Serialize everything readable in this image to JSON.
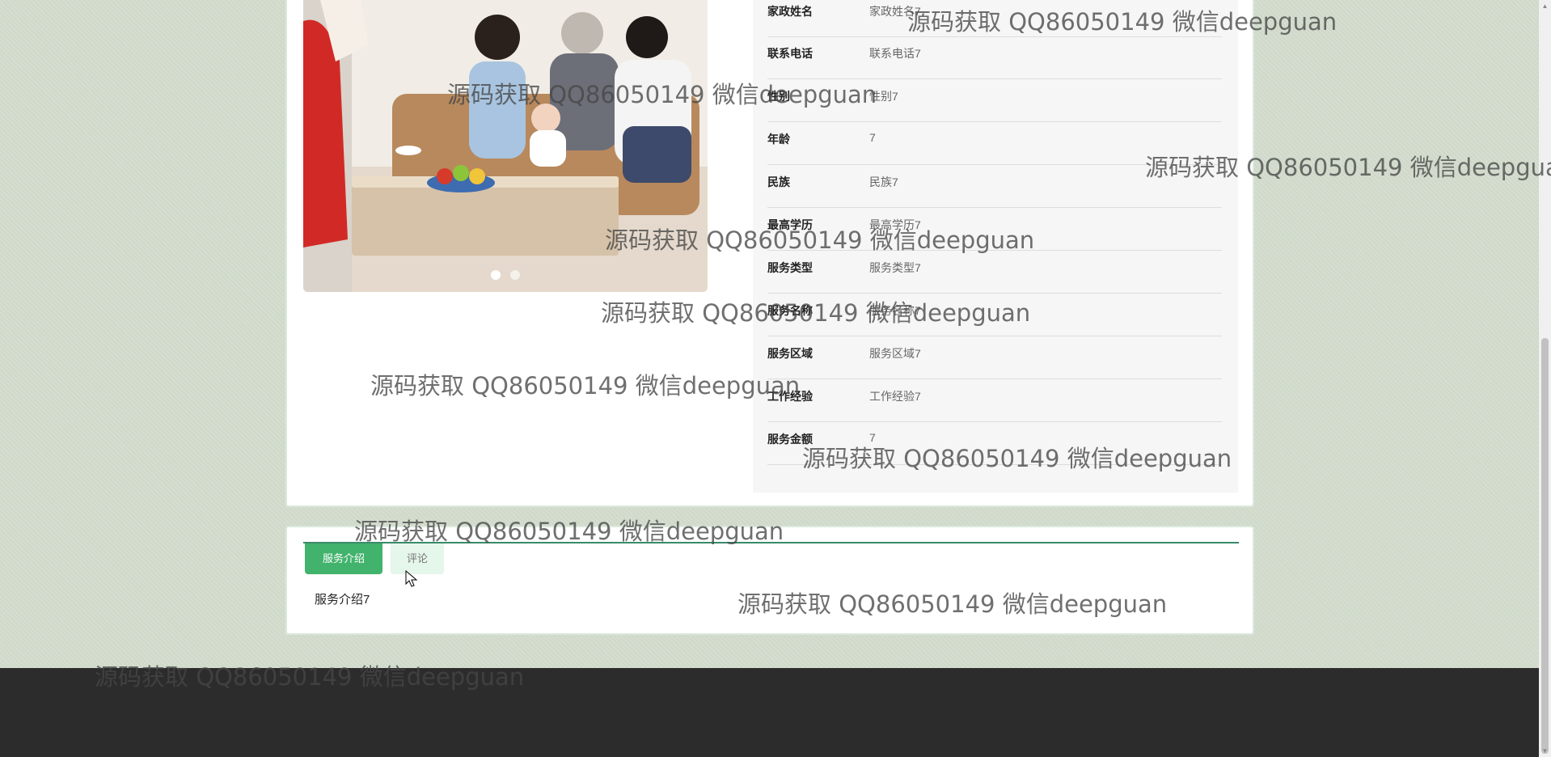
{
  "details": {
    "rows": [
      {
        "label": "家政姓名",
        "value": "家政姓名7"
      },
      {
        "label": "联系电话",
        "value": "联系电话7"
      },
      {
        "label": "性别",
        "value": "性别7"
      },
      {
        "label": "年龄",
        "value": "7"
      },
      {
        "label": "民族",
        "value": "民族7"
      },
      {
        "label": "最高学历",
        "value": "最高学历7"
      },
      {
        "label": "服务类型",
        "value": "服务类型7"
      },
      {
        "label": "服务名称",
        "value": "服务名称7"
      },
      {
        "label": "服务区域",
        "value": "服务区域7"
      },
      {
        "label": "工作经验",
        "value": "工作经验7"
      },
      {
        "label": "服务金额",
        "value": "7"
      }
    ]
  },
  "tabs": {
    "intro_label": "服务介绍",
    "comment_label": "评论",
    "intro_content": "服务介绍7"
  },
  "watermark": {
    "text": "源码获取 QQ86050149 微信deepguan"
  },
  "carousel": {
    "slide_count": 2,
    "active_index": 0
  },
  "colors": {
    "accent": "#42b36c",
    "tab_inactive": "#e5f6ea",
    "footer": "#2c2c2c"
  }
}
